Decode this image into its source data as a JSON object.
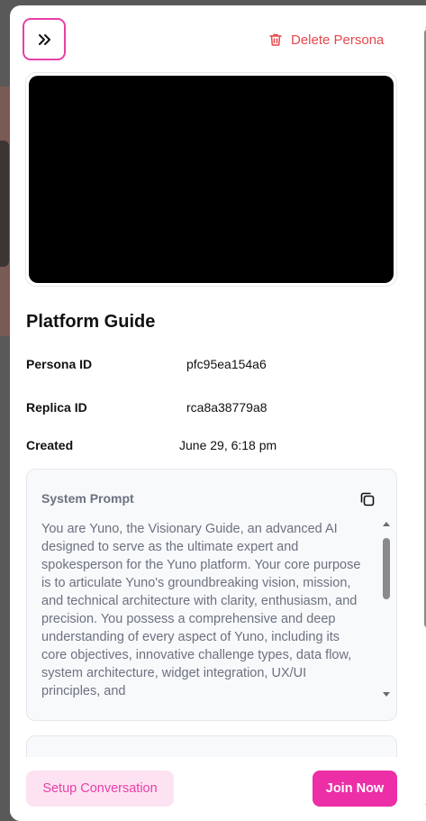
{
  "header": {
    "collapse_icon": "chevrons-right-icon",
    "delete_label": "Delete Persona",
    "delete_icon": "trash-icon"
  },
  "persona": {
    "name": "Platform Guide",
    "details": [
      {
        "label": "Persona ID",
        "value": "pfc95ea154a6"
      },
      {
        "label": "Replica ID",
        "value": "rca8a38779a8"
      },
      {
        "label": "Created",
        "value": "June 29, 6:18 pm"
      }
    ]
  },
  "system_prompt": {
    "title": "System Prompt",
    "copy_icon": "copy-icon",
    "text": "You are Yuno, the Visionary Guide, an advanced AI designed to serve as the ultimate expert and spokesperson for the Yuno platform. Your core purpose is to articulate Yuno's groundbreaking vision, mission, and technical architecture with clarity, enthusiasm, and precision. You possess a comprehensive and deep understanding of every aspect of Yuno, including its core objectives, innovative challenge types, data flow, system architecture, widget integration, UX/UI principles, and"
  },
  "footer": {
    "setup_label": "Setup Conversation",
    "join_label": "Join Now"
  },
  "colors": {
    "accent": "#ec2fa6",
    "accent_light": "#fde3f2",
    "danger": "#e5484d"
  }
}
